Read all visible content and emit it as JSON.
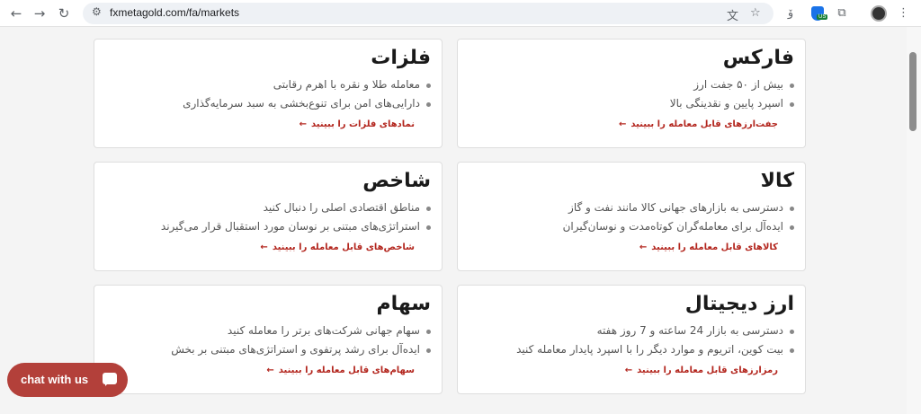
{
  "browser": {
    "url": "fxmetagold.com/fa/markets",
    "ext_badge": "US"
  },
  "cards": {
    "forex": {
      "title": "فارکس",
      "bullets": [
        "بیش از ۵۰ جفت ارز",
        "اسپرد پایین و نقدینگی بالا"
      ],
      "link": "جفت‌ارزهای قابل معامله را ببینید"
    },
    "metals": {
      "title": "فلزات",
      "bullets": [
        "معامله طلا و نقره با اهرم رقابتی",
        "دارایی‌های امن برای تنوع‌بخشی به سبد سرمایه‌گذاری"
      ],
      "link": "نمادهای فلزات را ببینید"
    },
    "commodities": {
      "title": "کالا",
      "bullets": [
        "دسترسی به بازارهای جهانی کالا مانند نفت و گاز",
        "ایده‌آل برای معامله‌گران کوتاه‌مدت و نوسان‌گیران"
      ],
      "link": "کالاهای قابل معامله را ببینید"
    },
    "indices": {
      "title": "شاخص",
      "bullets": [
        "مناطق اقتصادی اصلی را دنبال کنید",
        "استراتژی‌های مبتنی بر نوسان مورد استقبال قرار می‌گیرند"
      ],
      "link": "شاخص‌های قابل معامله را ببینید"
    },
    "crypto": {
      "title": "ارز دیجیتال",
      "bullets": [
        "دسترسی به بازار 24 ساعته و 7 روز هفته",
        "بیت کوین، اتریوم و موارد دیگر را با اسپرد پایدار معامله کنید"
      ],
      "link": "رمزارزهای قابل معامله را ببینید"
    },
    "stocks": {
      "title": "سهام",
      "bullets": [
        "سهام جهانی شرکت‌های برتر را معامله کنید",
        "ایده‌آل برای رشد پرتفوی و استراتژی‌های مبتنی بر بخش"
      ],
      "link": "سهام‌های قابل معامله را ببینید"
    }
  },
  "chat": {
    "label": "chat with us"
  }
}
